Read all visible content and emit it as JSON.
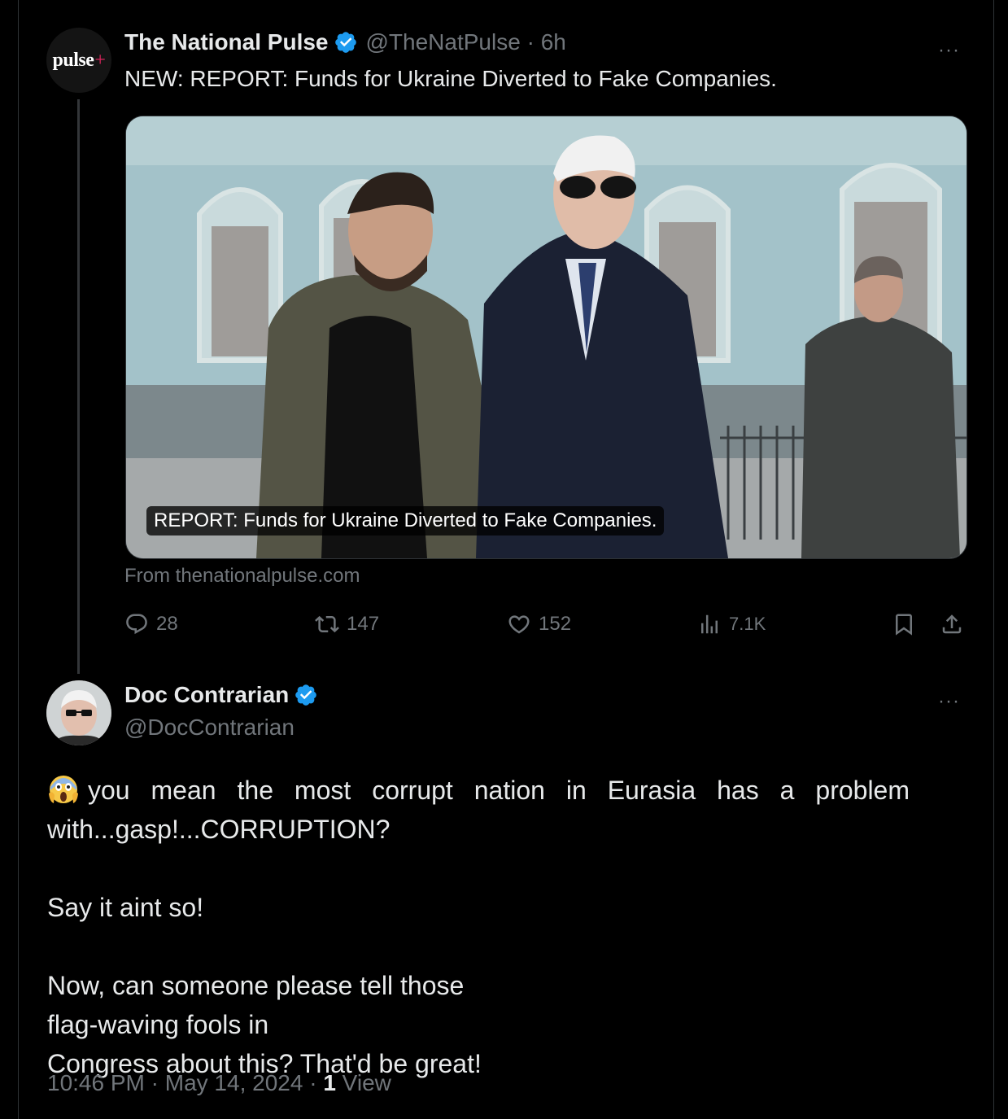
{
  "tweet1": {
    "author_name": "The National Pulse",
    "handle": "@TheNatPulse",
    "separator": "·",
    "time": "6h",
    "avatar_text": "pulse",
    "avatar_plus": "+",
    "text": "NEW: REPORT: Funds for Ukraine Diverted to Fake Companies.",
    "card": {
      "caption": "REPORT: Funds for Ukraine Diverted to Fake Companies.",
      "source": "From thenationalpulse.com"
    },
    "actions": {
      "replies": "28",
      "retweets": "147",
      "likes": "152",
      "views": "7.1K"
    },
    "more_label": "···"
  },
  "tweet2": {
    "author_name": "Doc Contrarian",
    "handle": "@DocContrarian",
    "more_label": "···",
    "line1": "you mean the most corrupt nation in Eurasia has a problem",
    "line2": "with...gasp!...CORRUPTION?",
    "line3": "Say it aint so!",
    "line4a": "Now, can someone please tell those",
    "line4b": "flag-waving fools in",
    "line5": "Congress about this? That'd be great!",
    "time": "10:46 PM",
    "date": "May 14, 2024",
    "separator": "·",
    "views_count": "1",
    "views_label": "View"
  },
  "colors": {
    "background": "#000000",
    "text": "#e7e9ea",
    "muted": "#71767b",
    "verified": "#1d9bf0",
    "border": "#2f3336",
    "flag_blue": "#1f5fd1",
    "flag_yellow": "#f7d21b"
  },
  "icons": [
    "verified-badge-icon",
    "more-icon",
    "reply-icon",
    "retweet-icon",
    "like-icon",
    "views-icon",
    "bookmark-icon",
    "share-icon",
    "face-screaming-emoji",
    "ukraine-flag-emoji"
  ]
}
